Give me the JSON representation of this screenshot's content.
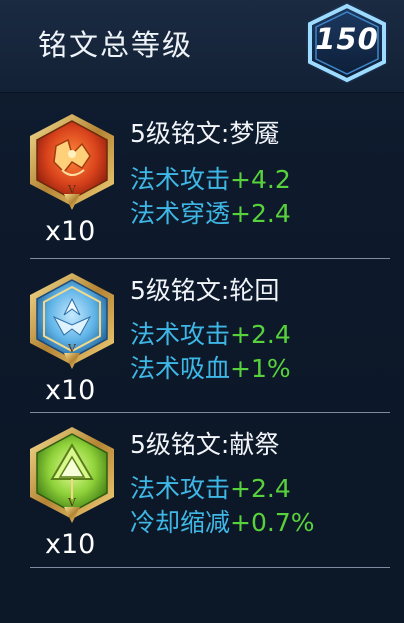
{
  "header": {
    "title": "铭文总等级",
    "level": "150"
  },
  "runes": [
    {
      "name": "5级铭文:梦魇",
      "count": "x10",
      "icon": "red-rune-icon",
      "stats": [
        {
          "label": "法术攻击",
          "value": "+4.2"
        },
        {
          "label": "法术穿透",
          "value": "+2.4"
        }
      ]
    },
    {
      "name": "5级铭文:轮回",
      "count": "x10",
      "icon": "blue-rune-icon",
      "stats": [
        {
          "label": "法术攻击",
          "value": "+2.4"
        },
        {
          "label": "法术吸血",
          "value": "+1%"
        }
      ]
    },
    {
      "name": "5级铭文:献祭",
      "count": "x10",
      "icon": "green-rune-icon",
      "stats": [
        {
          "label": "法术攻击",
          "value": "+2.4"
        },
        {
          "label": "冷却缩减",
          "value": "+0.7%"
        }
      ]
    }
  ],
  "colors": {
    "stat_label": "#3fb7e6",
    "stat_value": "#58d23c",
    "badge_border": "#7fd0ff"
  }
}
